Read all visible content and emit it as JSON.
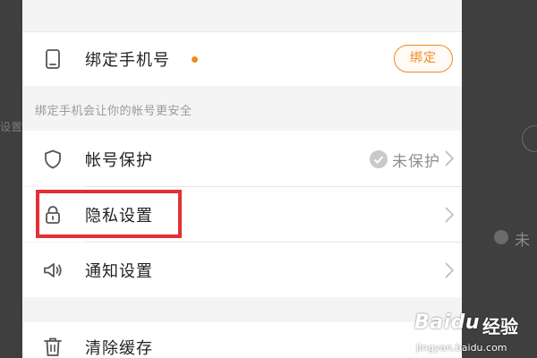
{
  "background": {
    "left_text": "设置",
    "right_text": "未"
  },
  "phone_row": {
    "label": "绑定手机号",
    "bind_button": "绑定",
    "hint": "绑定手机会让你的帐号更安全"
  },
  "settings": {
    "items": [
      {
        "label": "帐号保护",
        "icon": "shield-icon",
        "status": "未保护"
      },
      {
        "label": "隐私设置",
        "icon": "lock-icon"
      },
      {
        "label": "通知设置",
        "icon": "speaker-icon"
      },
      {
        "label": "清除缓存",
        "icon": "trash-icon"
      }
    ]
  },
  "watermark": {
    "brand": "Baidu",
    "product": "经验",
    "url": "jingyan.baidu.com"
  },
  "colors": {
    "accent": "#f08a1c",
    "highlight": "#e43033"
  }
}
